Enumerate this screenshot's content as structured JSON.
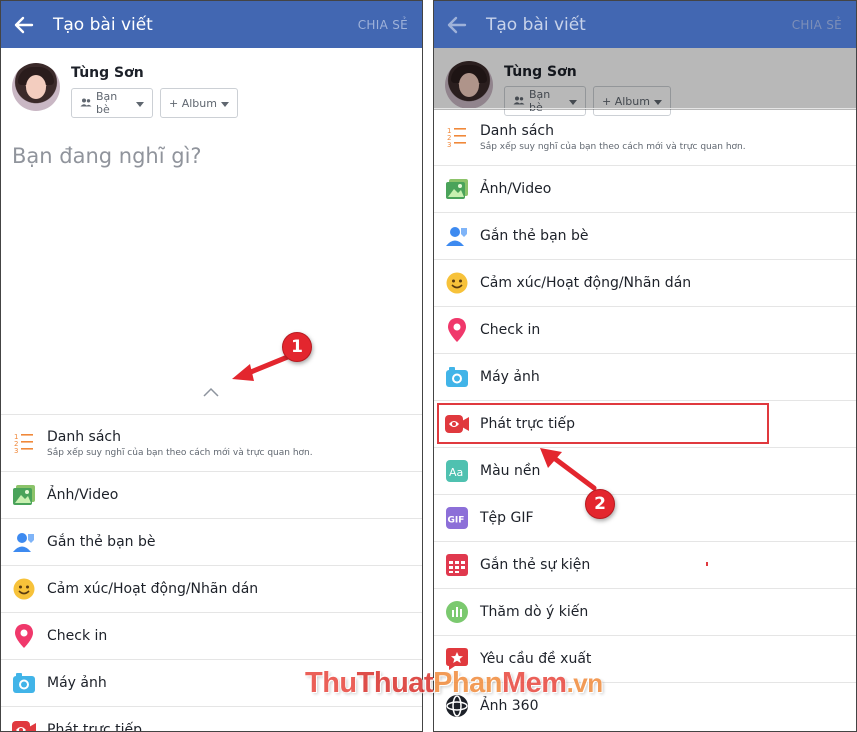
{
  "left": {
    "header": {
      "title": "Tạo bài viết",
      "share": "CHIA SẺ"
    },
    "user": {
      "name": "Tùng Sơn",
      "audience": "Bạn bè",
      "album": "+ Album"
    },
    "placeholder": "Bạn đang nghĩ gì?",
    "items": [
      {
        "label": "Danh sách",
        "sub": "Sắp xếp suy nghĩ của bạn theo cách mới và trực quan hơn.",
        "icon": "list-icon"
      },
      {
        "label": "Ảnh/Video",
        "icon": "photo-icon"
      },
      {
        "label": "Gắn thẻ bạn bè",
        "icon": "tag-friends-icon"
      },
      {
        "label": "Cảm xúc/Hoạt động/Nhãn dán",
        "icon": "emoji-icon"
      },
      {
        "label": "Check in",
        "icon": "location-pin-icon"
      },
      {
        "label": "Máy ảnh",
        "icon": "camera-icon"
      },
      {
        "label": "Phát trực tiếp",
        "icon": "live-video-icon"
      }
    ]
  },
  "right": {
    "header": {
      "title": "Tạo bài viết",
      "share": "CHIA SẺ"
    },
    "user": {
      "name": "Tùng Sơn",
      "audience": "Bạn bè",
      "album": "+ Album"
    },
    "items": [
      {
        "label": "Danh sách",
        "sub": "Sắp xếp suy nghĩ của bạn theo cách mới và trực quan hơn.",
        "icon": "list-icon"
      },
      {
        "label": "Ảnh/Video",
        "icon": "photo-icon"
      },
      {
        "label": "Gắn thẻ bạn bè",
        "icon": "tag-friends-icon"
      },
      {
        "label": "Cảm xúc/Hoạt động/Nhãn dán",
        "icon": "emoji-icon"
      },
      {
        "label": "Check in",
        "icon": "location-pin-icon"
      },
      {
        "label": "Máy ảnh",
        "icon": "camera-icon"
      },
      {
        "label": "Phát trực tiếp",
        "icon": "live-video-icon"
      },
      {
        "label": "Màu nền",
        "icon": "background-color-icon"
      },
      {
        "label": "Tệp GIF",
        "icon": "gif-icon"
      },
      {
        "label": "Gắn thẻ sự kiện",
        "icon": "event-calendar-icon"
      },
      {
        "label": "Thăm dò ý kiến",
        "icon": "poll-icon"
      },
      {
        "label": "Yêu cầu đề xuất",
        "icon": "recommendation-icon"
      },
      {
        "label": "Ảnh 360",
        "icon": "photo-360-icon"
      }
    ]
  },
  "annotations": {
    "step1": "1",
    "step2": "2"
  },
  "watermark": {
    "thu": "Thu",
    "thuat": "Thuat",
    "phan": "Phan",
    "mem": "Mem",
    "vn": ".vn"
  },
  "colors": {
    "header": "#4267b2",
    "highlight": "#e0393e",
    "badge": "#e3262e"
  }
}
